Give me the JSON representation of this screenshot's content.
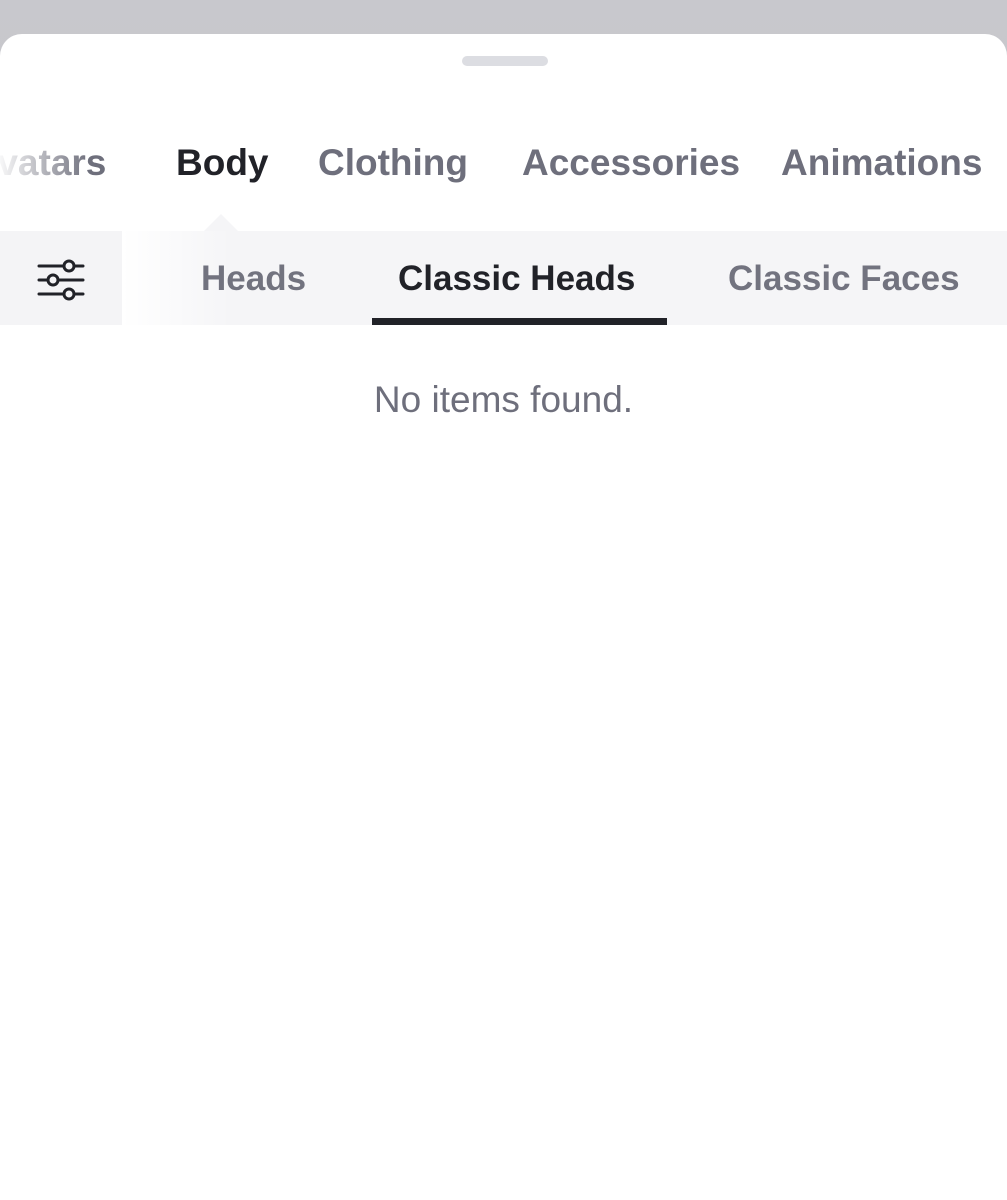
{
  "category_tabs": [
    {
      "label": "Avatars",
      "active": false
    },
    {
      "label": "Body",
      "active": true
    },
    {
      "label": "Clothing",
      "active": false
    },
    {
      "label": "Accessories",
      "active": false
    },
    {
      "label": "Animations",
      "active": false
    }
  ],
  "filter": {
    "icon": "sliders-icon"
  },
  "sub_tabs": [
    {
      "label": "Heads",
      "active": false
    },
    {
      "label": "Classic Heads",
      "active": true
    },
    {
      "label": "Classic Faces",
      "active": false
    }
  ],
  "content": {
    "empty_message": "No items found."
  },
  "colors": {
    "active_text": "#212228",
    "inactive_text": "#6e6f7c",
    "subbar_bg": "#f5f5f7"
  }
}
